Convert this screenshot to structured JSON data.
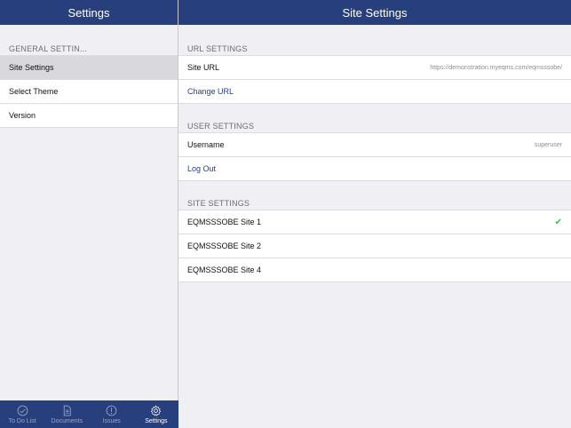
{
  "left": {
    "title": "Settings",
    "section": "GENERAL SETTIN...",
    "items": [
      {
        "label": "Site Settings"
      },
      {
        "label": "Select Theme"
      },
      {
        "label": "Version"
      }
    ]
  },
  "right": {
    "title": "Site Settings",
    "url_section": {
      "header": "URL SETTINGS",
      "site_url_label": "Site URL",
      "site_url_value": "https://demonstration.myeqms.com/eqmsssobe/",
      "change_url": "Change URL"
    },
    "user_section": {
      "header": "USER SETTINGS",
      "username_label": "Username",
      "username_value": "superuser",
      "logout": "Log Out"
    },
    "site_section": {
      "header": "SITE SETTINGS",
      "sites": [
        "EQMSSSOBE Site 1",
        "EQMSSSOBE Site 2",
        "EQMSSSOBE Site 4"
      ]
    }
  },
  "tabs": [
    {
      "label": "To Do List",
      "icon": "checkmark-circle-icon"
    },
    {
      "label": "Documents",
      "icon": "document-icon"
    },
    {
      "label": "Issues",
      "icon": "alert-circle-icon"
    },
    {
      "label": "Settings",
      "icon": "gear-icon"
    }
  ],
  "colors": {
    "brand": "#283f7d",
    "check": "#3cbf4a",
    "background": "#efeff4"
  }
}
